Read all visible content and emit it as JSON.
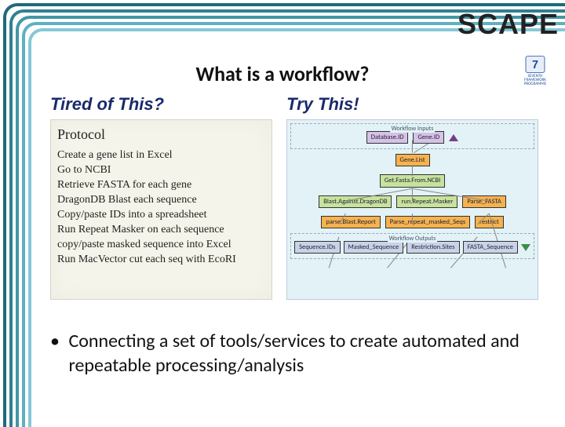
{
  "brand": "SCAPE",
  "title": "What is a workflow?",
  "fp7_label": "SEVENTH FRAMEWORK PROGRAMME",
  "left": {
    "heading": "Tired of This?",
    "protocol_label": "Protocol",
    "steps": [
      "Create a gene list in Excel",
      "Go to NCBI",
      "Retrieve FASTA for each gene",
      "DragonDB Blast each sequence",
      "Copy/paste IDs into a spreadsheet",
      "Run Repeat Masker on each sequence",
      "copy/paste masked sequence into Excel",
      "Run MacVector cut each seq with EcoRI"
    ]
  },
  "right": {
    "heading": "Try This!",
    "inputs_label": "Workflow Inputs",
    "outputs_label": "Workflow Outputs",
    "nodes": {
      "databaseId": "Database.ID",
      "geneId": "Gene.ID",
      "geneList": "Gene.List",
      "getFasta": "Get.Fasta.From.NCBI",
      "blast": "Blast.Against.DragonDB",
      "repeatMasker": "run.Repeat.Masker",
      "parseFasta": "Parse_FASTA",
      "parseBlast": "parse.Blast.Report",
      "parseRepeat": "Parse_repeat_masked_Seqs",
      "restrict": "restrict",
      "seqIds": "Sequence.IDs",
      "maskedSeq": "Masked_Sequence",
      "restrictionSites": "Restriction.Sites",
      "fastaSeq": "FASTA_Sequence"
    }
  },
  "bullet": "Connecting a set of tools/services to create automated and repeatable processing/analysis"
}
